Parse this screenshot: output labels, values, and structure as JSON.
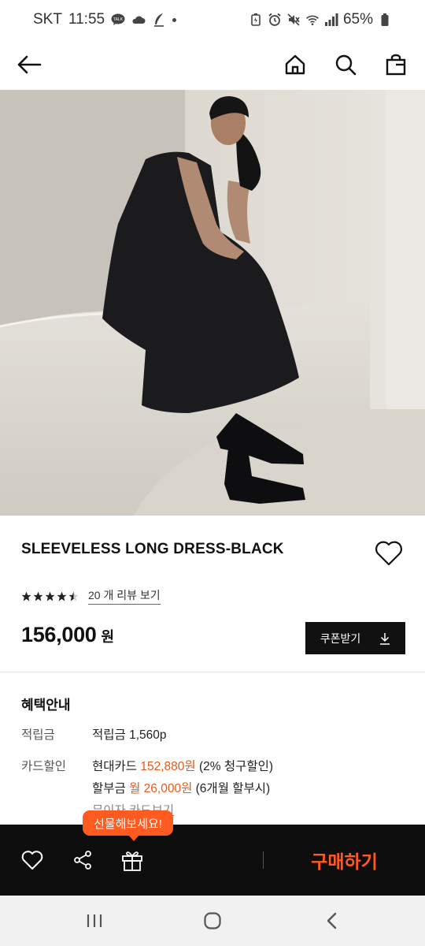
{
  "status_bar": {
    "carrier": "SKT",
    "time": "11:55",
    "notification_icons": [
      "talk-icon",
      "cloud-icon",
      "feather-icon"
    ],
    "system_icons": [
      "battery-saver-icon",
      "alarm-icon",
      "mute-icon",
      "wifi-icon",
      "signal-icon"
    ],
    "battery": "65%"
  },
  "nav": {
    "icons": [
      "back-arrow-icon",
      "home-icon",
      "search-icon",
      "bag-icon"
    ]
  },
  "product": {
    "name": "SLEEVELESS LONG DRESS-BLACK",
    "rating": 4.5,
    "rating_max": 5,
    "review_link": "20 개 리뷰 보기",
    "price": "156,000",
    "price_unit": "원",
    "coupon_label": "쿠폰받기"
  },
  "benefits": {
    "title": "혜택안내",
    "points_label": "적립금",
    "points_text": "적립금 1,560p",
    "card_label": "카드할인",
    "card_line1_prefix": "현대카드 ",
    "card_line1_amount": "152,880원",
    "card_line1_suffix": " (2% 청구할인)",
    "card_line2_prefix": "할부금 ",
    "card_line2_amount": "월 26,000원",
    "card_line2_suffix": " (6개월 할부시)",
    "card_line3": "무이자 카드보기"
  },
  "bottom_bar": {
    "gift_tooltip": "선물해보세요!",
    "buy_label": "구매하기"
  },
  "colors": {
    "accent": "#ff5a1f",
    "highlight": "#e45a1b",
    "bar": "#0e0e0e"
  }
}
